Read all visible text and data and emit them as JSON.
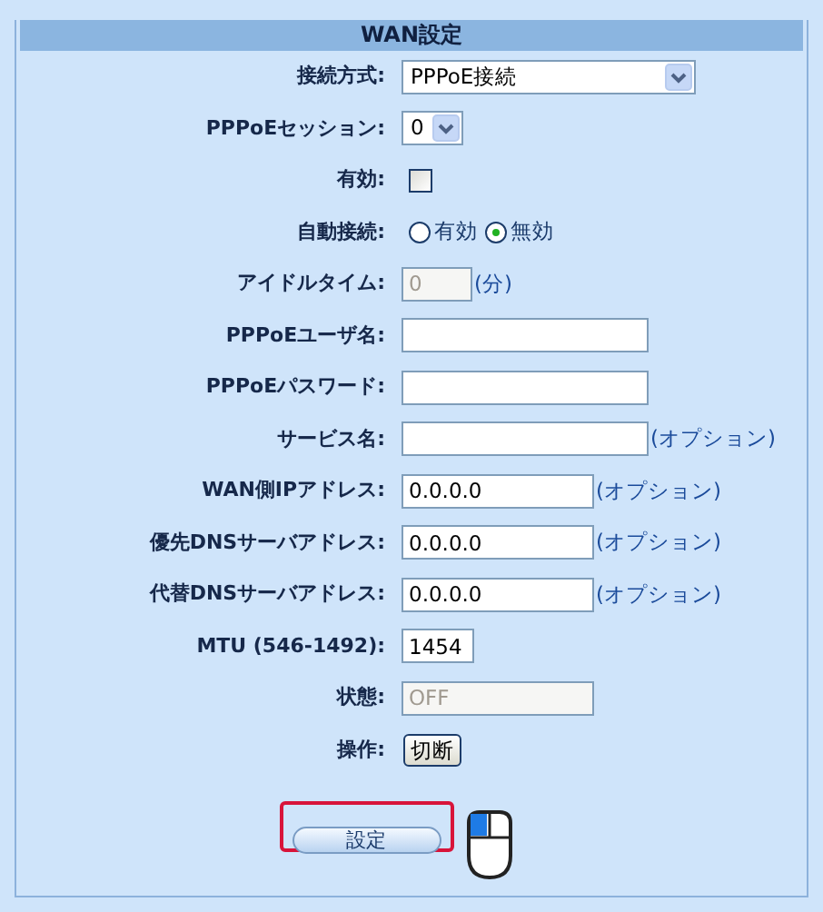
{
  "panel": {
    "title": "WAN設定"
  },
  "rows": [
    {
      "label": "接続方式:",
      "kind": "select",
      "value": "PPPoE接続"
    },
    {
      "label": "PPPoEセッション:",
      "kind": "select",
      "value": "0"
    },
    {
      "label": "有効:",
      "kind": "checkbox",
      "checked": false
    },
    {
      "label": "自動接続:",
      "kind": "radio",
      "options": [
        {
          "label": "有効",
          "selected": false
        },
        {
          "label": "無効",
          "selected": true
        }
      ]
    },
    {
      "label": "アイドルタイム:",
      "kind": "text",
      "value": "0",
      "disabled": true,
      "note": "(分)"
    },
    {
      "label": "PPPoEユーザ名:",
      "kind": "text"
    },
    {
      "label": "PPPoEパスワード:",
      "kind": "text"
    },
    {
      "label": "サービス名:",
      "kind": "text",
      "note": "(オプション)"
    },
    {
      "label": "WAN側IPアドレス:",
      "kind": "text",
      "value": "0.0.0.0",
      "disabled": false,
      "note": "(オプション)"
    },
    {
      "label": "優先DNSサーバアドレス:",
      "kind": "text",
      "value": "0.0.0.0",
      "disabled": false,
      "note": "(オプション)"
    },
    {
      "label": "代替DNSサーバアドレス:",
      "kind": "text",
      "value": "0.0.0.0",
      "disabled": false,
      "note": "(オプション)"
    },
    {
      "label": "MTU (546-1492):",
      "kind": "text",
      "value": "1454",
      "disabled": false
    },
    {
      "label": "状態:",
      "kind": "text",
      "value": "OFF",
      "disabled": true
    },
    {
      "label": "操作:",
      "kind": "button",
      "value": "切断"
    }
  ],
  "submit": {
    "label": "設定",
    "highlighted": true
  }
}
